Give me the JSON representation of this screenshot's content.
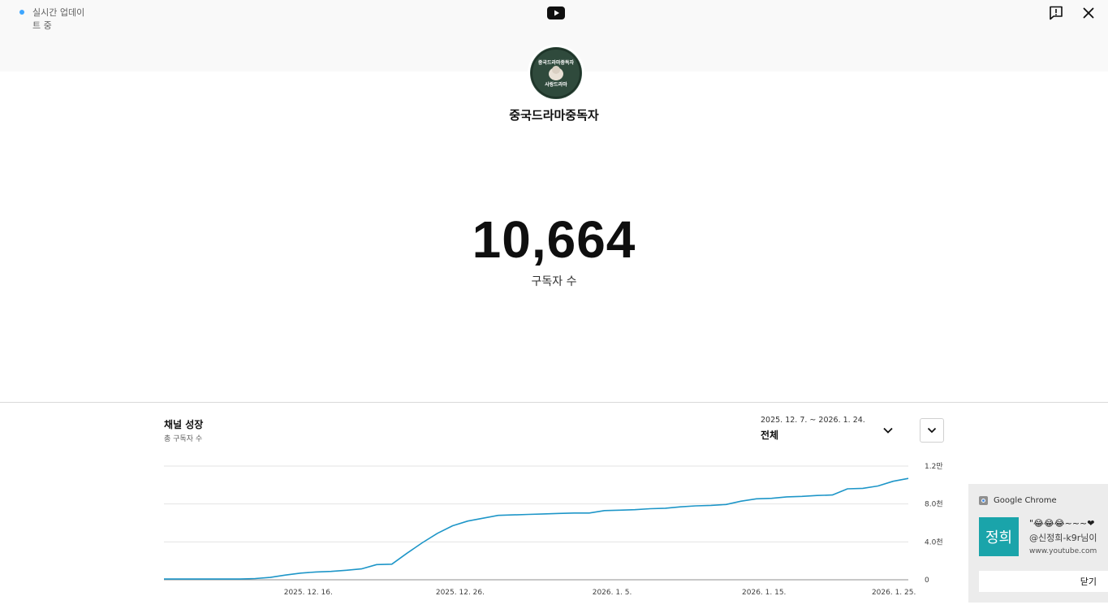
{
  "header": {
    "live_status": "실시간 업데이트 중"
  },
  "channel": {
    "name": "중국드라마중독자",
    "avatar_text_top": "중국드라마중독자",
    "avatar_text_bottom": "사랑드라마"
  },
  "stats": {
    "subscriber_count": "10,664",
    "subscriber_label": "구독자 수"
  },
  "growth": {
    "title": "채널 성장",
    "subtitle": "총 구독자 수",
    "date_range": "2025. 12. 7. ~ 2026. 1. 24.",
    "range_value": "전체"
  },
  "chart_data": {
    "type": "line",
    "x_tick_labels": [
      "2025. 12. 16.",
      "2025. 12. 26.",
      "2026. 1. 5.",
      "2026. 1. 15.",
      "2026. 1. 25."
    ],
    "y_tick_labels": [
      "0",
      "4.0천",
      "8.0천",
      "1.2만"
    ],
    "ylim": [
      0,
      12000
    ],
    "grid": true,
    "color": "#1e96c8",
    "series": [
      {
        "values": [
          80,
          80,
          80,
          80,
          80,
          80,
          130,
          250,
          500,
          700,
          820,
          880,
          1000,
          1150,
          1600,
          1650,
          2800,
          3900,
          4900,
          5700,
          6200,
          6500,
          6800,
          6850,
          6900,
          6950,
          7000,
          7050,
          7050,
          7300,
          7350,
          7400,
          7500,
          7550,
          7700,
          7800,
          7850,
          7950,
          8300,
          8550,
          8600,
          8750,
          8800,
          8900,
          8950,
          9600,
          9650,
          9900,
          10400,
          10700
        ]
      }
    ]
  },
  "notification": {
    "app": "Google Chrome",
    "avatar_text": "정희",
    "message": "\"😂😂😂~~~❤",
    "author": "@신정희-k9r님이",
    "site": "www.youtube.com",
    "close_label": "닫기"
  }
}
